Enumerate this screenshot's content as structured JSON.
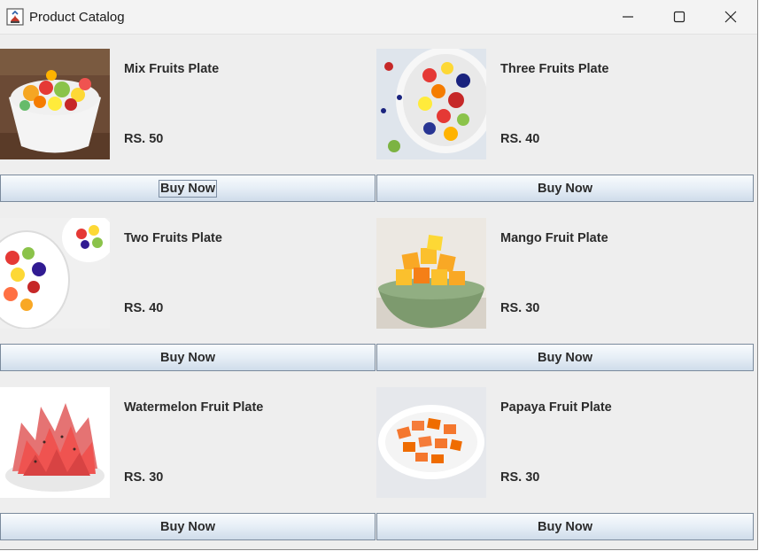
{
  "window": {
    "title": "Product Catalog",
    "controls": [
      "minimize",
      "maximize",
      "close"
    ]
  },
  "products": [
    {
      "name": "Mix Fruits Plate",
      "price": "RS. 50",
      "button": "Buy Now",
      "image": "mixed-fruit-bowl-image"
    },
    {
      "name": "Three Fruits Plate",
      "price": "RS. 40",
      "button": "Buy Now",
      "image": "fruit-salad-bowl-image"
    },
    {
      "name": "Two Fruits Plate",
      "price": "RS. 40",
      "button": "Buy Now",
      "image": "berry-fruit-bowl-image"
    },
    {
      "name": "Mango Fruit Plate",
      "price": "RS. 30",
      "button": "Buy Now",
      "image": "mango-cubes-bowl-image"
    },
    {
      "name": "Watermelon Fruit Plate",
      "price": "RS. 30",
      "button": "Buy Now",
      "image": "watermelon-pieces-bowl-image"
    },
    {
      "name": "Papaya Fruit Plate",
      "price": "RS. 30",
      "button": "Buy Now",
      "image": "papaya-cubes-bowl-image"
    }
  ],
  "colors": {
    "background": "#eeeeee",
    "button_border": "#7a8a9c",
    "text": "#2b2b2b"
  }
}
